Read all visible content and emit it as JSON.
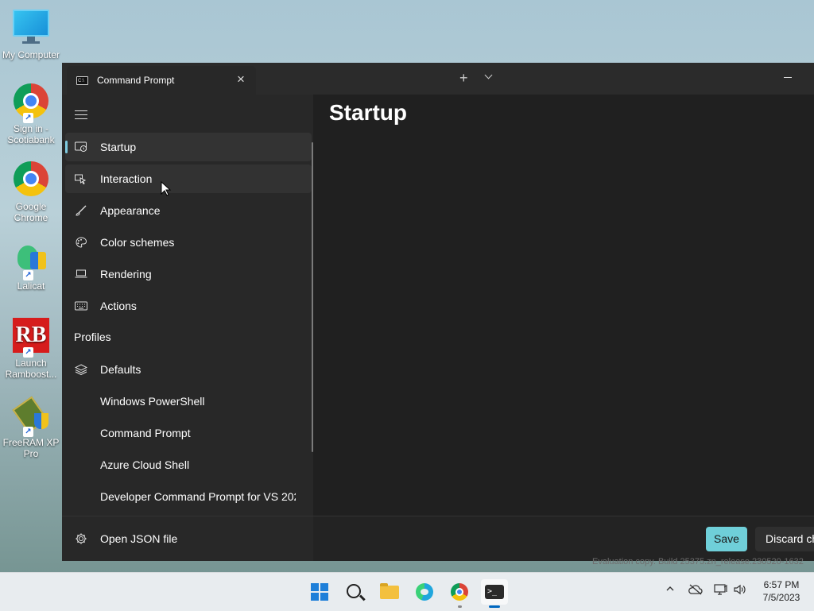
{
  "desktop": {
    "icons": [
      {
        "label": "My Computer",
        "icon": "monitor-icon"
      },
      {
        "label": "Sign in - Scotiabank",
        "icon": "chrome-icon"
      },
      {
        "label": "Google Chrome",
        "icon": "chrome-icon"
      },
      {
        "label": "Lalicat",
        "icon": "lalicat-icon"
      },
      {
        "label": "Launch Ramboost...",
        "icon": "ramboost-icon"
      },
      {
        "label": "FreeRAM XP Pro",
        "icon": "freeram-icon"
      }
    ]
  },
  "window": {
    "tab_title": "Command Prompt",
    "tab_icon_text": "C:\\",
    "page_title": "Startup"
  },
  "nav": {
    "items": [
      {
        "label": "Startup",
        "icon": "startup-icon",
        "selected": true
      },
      {
        "label": "Interaction",
        "icon": "interaction-icon"
      },
      {
        "label": "Appearance",
        "icon": "brush-icon"
      },
      {
        "label": "Color schemes",
        "icon": "palette-icon"
      },
      {
        "label": "Rendering",
        "icon": "laptop-icon"
      },
      {
        "label": "Actions",
        "icon": "keyboard-icon"
      }
    ],
    "profiles_header": "Profiles",
    "profiles": [
      {
        "label": "Defaults",
        "icon": "layers-icon"
      },
      {
        "label": "Windows PowerShell"
      },
      {
        "label": "Command Prompt"
      },
      {
        "label": "Azure Cloud Shell"
      },
      {
        "label": "Developer Command Prompt for VS 202"
      }
    ],
    "open_json": "Open JSON file"
  },
  "footer": {
    "save": "Save",
    "discard": "Discard ch"
  },
  "watermark": "Evaluation copy. Build 25375.zn_release.230520-1632",
  "taskbar": {
    "time": "6:57 PM",
    "date": "7/5/2023"
  },
  "colors": {
    "accent": "#6fcfd9",
    "window_bg": "#202020",
    "nav_bg": "#282828"
  }
}
